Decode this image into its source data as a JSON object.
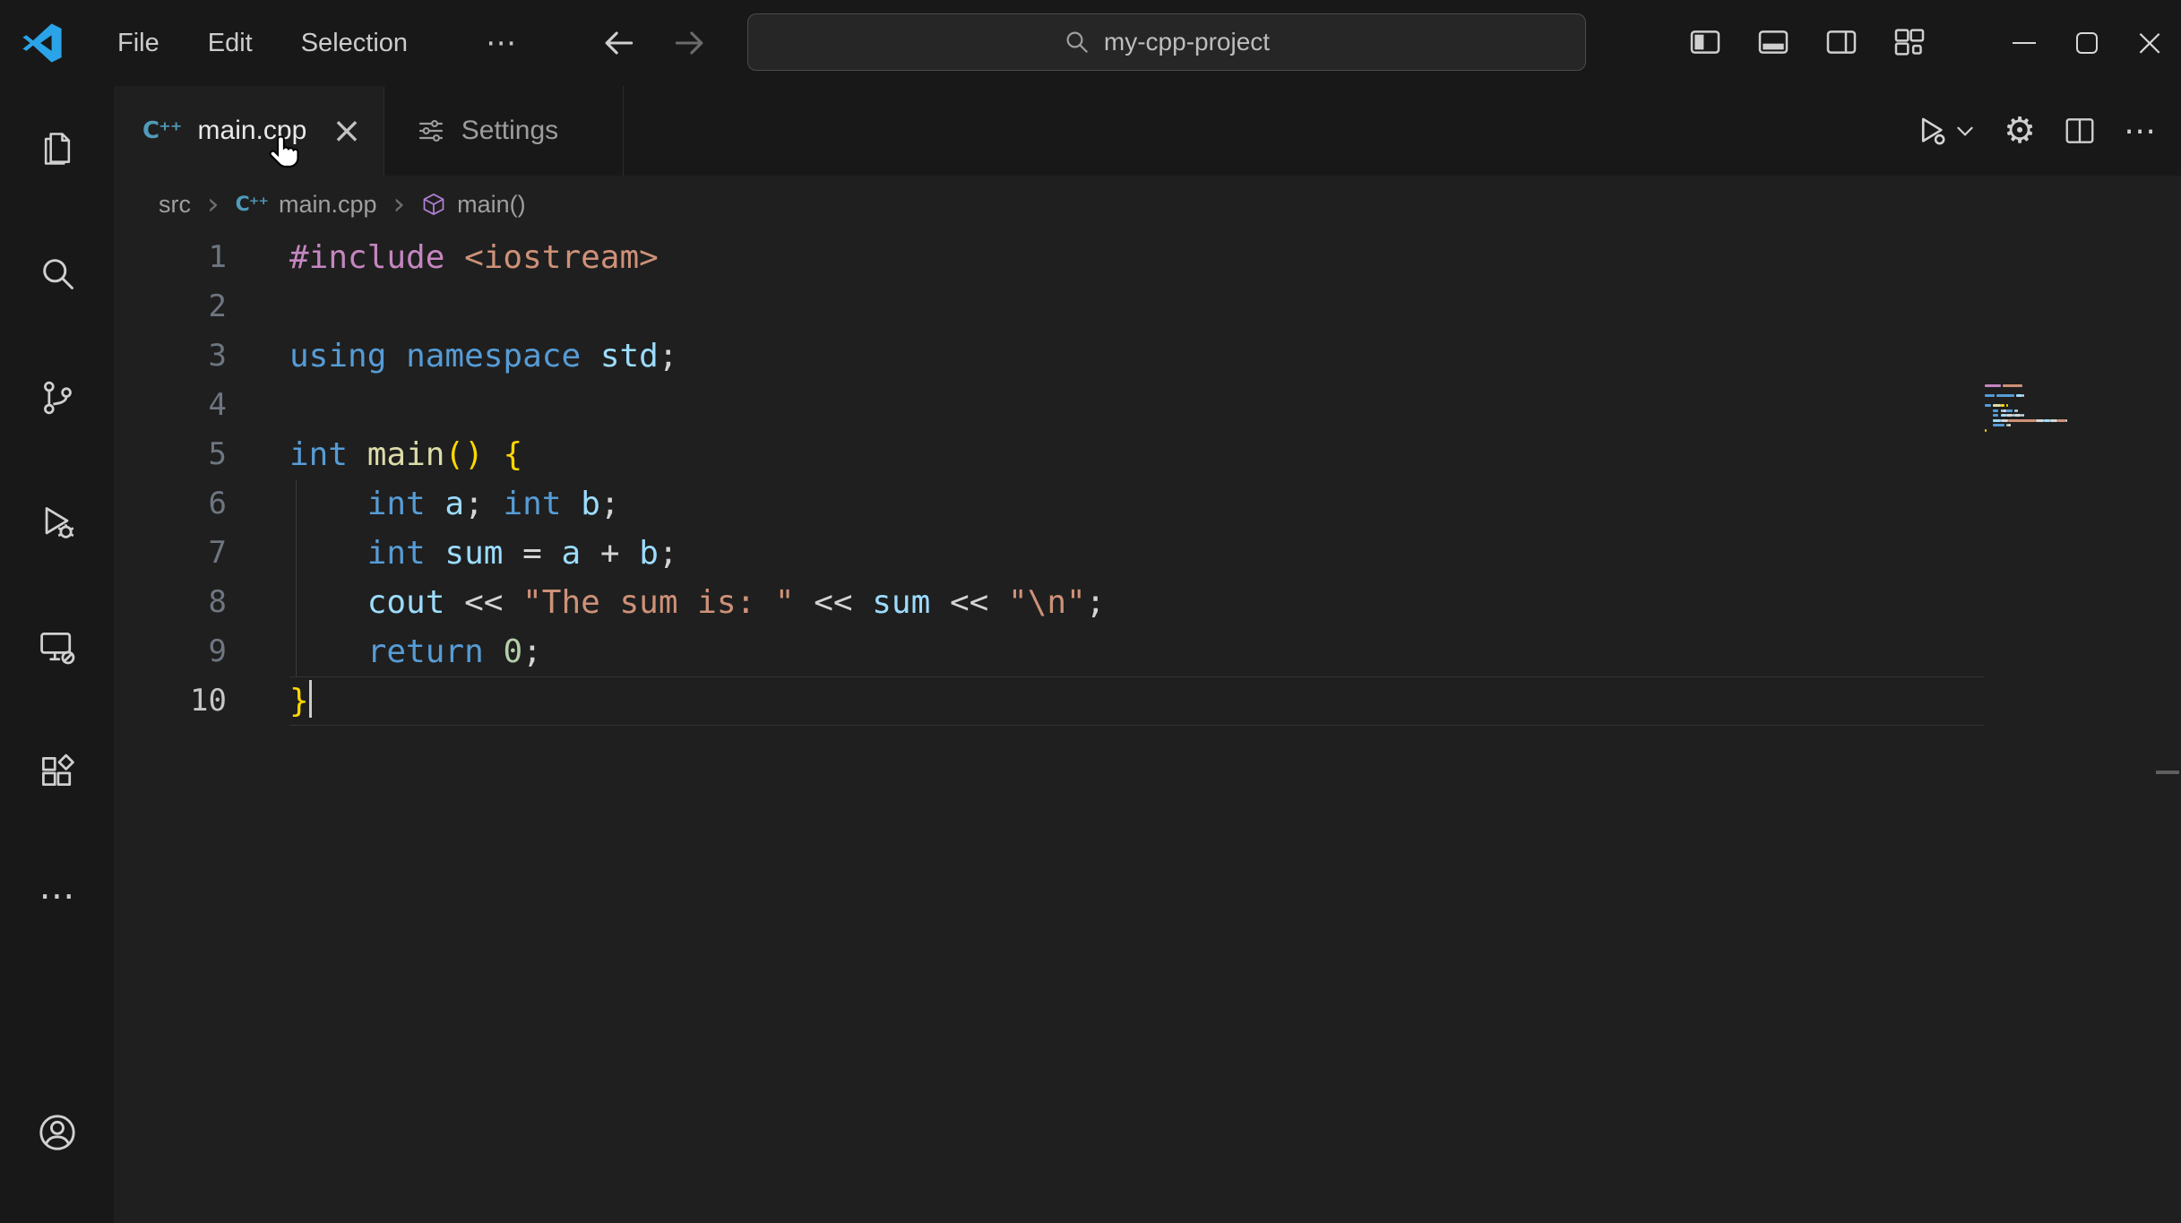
{
  "titlebar": {
    "menus": [
      {
        "label": "File"
      },
      {
        "label": "Edit"
      },
      {
        "label": "Selection"
      }
    ],
    "overflow_label": "⋯",
    "search": {
      "value": "my-cpp-project"
    }
  },
  "window_controls": {
    "minimize": "minimize",
    "maximize": "maximize",
    "close": "×"
  },
  "tabs": [
    {
      "label": "main.cpp",
      "icon": "cpp-file-icon",
      "active": true,
      "close_label": "×"
    },
    {
      "label": "Settings",
      "icon": "settings-sliders-icon",
      "active": false
    }
  ],
  "breadcrumb": {
    "items": [
      {
        "label": "src"
      },
      {
        "label": "main.cpp",
        "icon": "cpp-file-icon"
      },
      {
        "label": "main()",
        "icon": "symbol-method-icon"
      }
    ],
    "separator": "›"
  },
  "activity_bar": {
    "items": [
      "explorer",
      "search",
      "source-control",
      "run-and-debug",
      "remote-explorer",
      "extensions",
      "more"
    ],
    "bottom_items": [
      "account"
    ],
    "more_label": "⋯"
  },
  "colors": {
    "editor_bg": "#1f1f1f",
    "chrome_bg": "#181818",
    "accent_blue": "#2BA3E8",
    "cpp_icon_blue": "#519aba",
    "symbol_method_purple": "#B180D7",
    "token_preprocessor": "#C586C0",
    "token_string": "#CE9178",
    "token_keyword": "#569CD6",
    "token_variable": "#9CDCFE",
    "token_function": "#DCDCAA",
    "token_number": "#B5CEA8",
    "token_bracket": "#FFD700",
    "token_plain": "#D4D4D4"
  },
  "cpp_glyph_text": "C⁺⁺",
  "editor": {
    "lines": [
      {
        "num": "1",
        "tokens": [
          [
            "pre",
            "#include"
          ],
          [
            "pl",
            " "
          ],
          [
            "str",
            "<iostream>"
          ]
        ]
      },
      {
        "num": "2",
        "tokens": []
      },
      {
        "num": "3",
        "tokens": [
          [
            "kw",
            "using"
          ],
          [
            "pl",
            " "
          ],
          [
            "kw",
            "namespace"
          ],
          [
            "pl",
            " "
          ],
          [
            "var",
            "std"
          ],
          [
            "pl",
            ";"
          ]
        ]
      },
      {
        "num": "4",
        "tokens": []
      },
      {
        "num": "5",
        "tokens": [
          [
            "kw",
            "int"
          ],
          [
            "pl",
            " "
          ],
          [
            "fn",
            "main"
          ],
          [
            "brk",
            "()"
          ],
          [
            "pl",
            " "
          ],
          [
            "brk",
            "{"
          ]
        ]
      },
      {
        "num": "6",
        "tokens": [
          [
            "pl",
            "    "
          ],
          [
            "kw",
            "int"
          ],
          [
            "pl",
            " "
          ],
          [
            "var",
            "a"
          ],
          [
            "pl",
            "; "
          ],
          [
            "kw",
            "int"
          ],
          [
            "pl",
            " "
          ],
          [
            "var",
            "b"
          ],
          [
            "pl",
            ";"
          ]
        ],
        "guide": true
      },
      {
        "num": "7",
        "tokens": [
          [
            "pl",
            "    "
          ],
          [
            "kw",
            "int"
          ],
          [
            "pl",
            " "
          ],
          [
            "var",
            "sum"
          ],
          [
            "pl",
            " = "
          ],
          [
            "var",
            "a"
          ],
          [
            "pl",
            " + "
          ],
          [
            "var",
            "b"
          ],
          [
            "pl",
            ";"
          ]
        ],
        "guide": true
      },
      {
        "num": "8",
        "tokens": [
          [
            "pl",
            "    "
          ],
          [
            "var",
            "cout"
          ],
          [
            "pl",
            " << "
          ],
          [
            "str",
            "\"The sum is: \""
          ],
          [
            "pl",
            " << "
          ],
          [
            "var",
            "sum"
          ],
          [
            "pl",
            " << "
          ],
          [
            "str",
            "\"\\n\""
          ],
          [
            "pl",
            ";"
          ]
        ],
        "guide": true
      },
      {
        "num": "9",
        "tokens": [
          [
            "pl",
            "    "
          ],
          [
            "kw",
            "return"
          ],
          [
            "pl",
            " "
          ],
          [
            "num",
            "0"
          ],
          [
            "pl",
            ";"
          ]
        ],
        "guide": true
      },
      {
        "num": "10",
        "tokens": [
          [
            "brk",
            "}"
          ]
        ],
        "current": true,
        "cursor": true
      }
    ]
  }
}
